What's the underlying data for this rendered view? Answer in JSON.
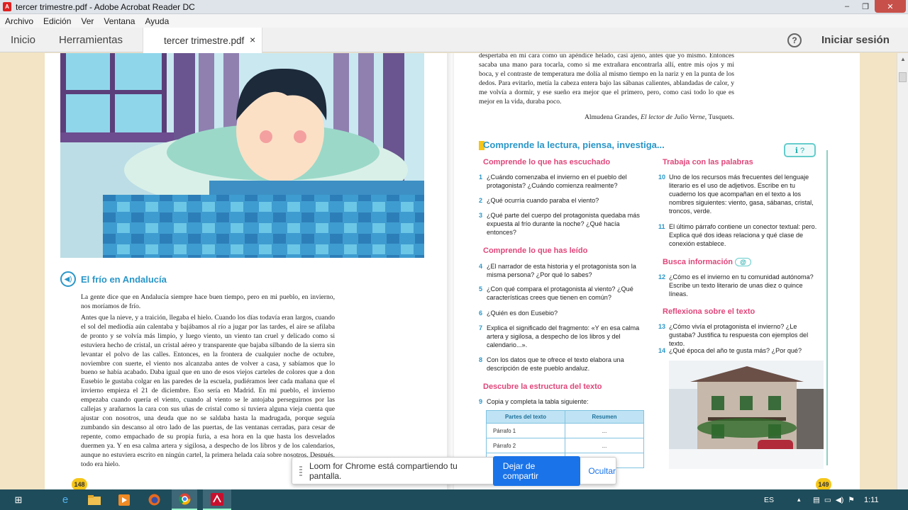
{
  "window": {
    "title": "tercer trimestre.pdf - Adobe Acrobat Reader DC",
    "min": "–",
    "max": "❐",
    "close": "✕"
  },
  "menu": [
    "Archivo",
    "Edición",
    "Ver",
    "Ventana",
    "Ayuda"
  ],
  "tabs": {
    "home": "Inicio",
    "tools": "Herramientas",
    "doc": "tercer trimestre.pdf",
    "doc_close": "×"
  },
  "help_icon": "?",
  "signin": "Iniciar sesión",
  "left_page": {
    "icon": "speaker-icon",
    "title": "El frío en Andalucía",
    "p1": "La gente dice que en Andalucía siempre hace buen tiempo, pero en mi pueblo, en invierno, nos moríamos de frío.",
    "p2": "Antes que la nieve, y a traición, llegaba el hielo. Cuando los días todavía eran largos, cuando el sol del mediodía aún calentaba y bajábamos al río a jugar por las tardes, el aire se afilaba de pronto y se volvía más limpio, y luego viento, un viento tan cruel y delicado como si estuviera hecho de cristal, un cristal aéreo y transparente que bajaba silbando de la sierra sin levantar el polvo de las calles. Entonces, en la frontera de cualquier noche de octubre, noviembre con suerte, el viento nos alcanzaba antes de volver a casa, y sabíamos que lo bueno se había acabado. Daba igual que en uno de esos viejos carteles de colores que a don Eusebio le gustaba colgar en las paredes de la escuela, pudiéramos leer cada mañana que el invierno empieza el 21 de diciembre. Eso sería en Madrid. En mi pueblo, el invierno empezaba cuando quería el viento, cuando al viento se le antojaba perseguirnos por las callejas y arañarnos la cara con sus uñas de cristal como si tuviera alguna vieja cuenta que ajustar con nosotros, una deuda que no se saldaba hasta la madrugada, porque seguía zumbando sin descanso al otro lado de las puertas, de las ventanas cerradas, para cesar de repente, como empachado de su propia furia, a esa hora en la que hasta los desvelados duermen ya. Y en esa calma artera y sigilosa, a despecho de los libros y de los calendarios, aunque no estuviera escrito en ningún cartel, la primera helada caía sobre nosotros. Después, todo era hielo.",
    "page_number": "148"
  },
  "right_page": {
    "top_text": "despertaba en mi cara como un apéndice helado, casi ajeno, antes que yo mismo. Entonces sacaba una mano para tocarla, como si me extrañara encontrarla allí, entre mis ojos y mi boca, y el contraste de temperatura me dolía al mismo tiempo en la nariz y en la punta de los dedos. Para evitarlo, metía la cabeza entera bajo las sábanas calientes, ablandadas de calor, y me volvía a dormir, y ese sueño era mejor que el primero, pero, como casi todo lo que es mejor en la vida, duraba poco.",
    "credit_author": "Almudena Grandes, ",
    "credit_book": "El lector de Julio Verne",
    "credit_publisher": ", Tusquets.",
    "section_first": "C",
    "section_rest": "omprende la lectura, piensa, investiga...",
    "section_badge": "ℹ ?",
    "headings": {
      "h1": "Comprende lo que has escuchado",
      "h2": "Comprende lo que has leído",
      "h3": "Descubre la estructura del texto",
      "h4": "Trabaja con las palabras",
      "h5": "Busca información",
      "h5_badge": "@",
      "h6": "Reflexiona sobre el texto"
    },
    "questions": [
      {
        "n": "1",
        "t": "¿Cuándo comenzaba el invierno en el pueblo del protagonista? ¿Cuándo comienza realmente?"
      },
      {
        "n": "2",
        "t": "¿Qué ocurría cuando paraba el viento?"
      },
      {
        "n": "3",
        "t": "¿Qué parte del cuerpo del protagonista quedaba más expuesta al frío durante la noche? ¿Qué hacía entonces?"
      },
      {
        "n": "4",
        "t": "¿El narrador de esta historia y el protagonista son la misma persona? ¿Por qué lo sabes?"
      },
      {
        "n": "5",
        "t": "¿Con qué compara el protagonista al viento? ¿Qué características crees que tienen en común?"
      },
      {
        "n": "6",
        "t": "¿Quién es don Eusebio?"
      },
      {
        "n": "7",
        "t": "Explica el significado del fragmento: «Y en esa calma artera y sigilosa, a despecho de los libros y del calendario...»."
      },
      {
        "n": "8",
        "t": "Con los datos que te ofrece el texto elabora una descripción de este pueblo andaluz."
      },
      {
        "n": "9",
        "t": "Copia y completa la tabla siguiente:"
      },
      {
        "n": "10",
        "t": "Uno de los recursos más frecuentes del lenguaje literario es el uso de adjetivos. Escribe en tu cuaderno los que acompañan en el texto a los nombres siguientes: viento, gasa, sábanas, cristal, troncos, verde."
      },
      {
        "n": "11",
        "t": "El último párrafo contiene un conector textual: pero. Explica qué dos ideas relaciona y qué clase de conexión establece."
      },
      {
        "n": "12",
        "t": "¿Cómo es el invierno en tu comunidad autónoma? Escribe un texto literario de unas diez o quince líneas."
      },
      {
        "n": "13",
        "t": "¿Cómo vivía el protagonista el invierno? ¿Le gustaba? Justifica tu respuesta con ejemplos del texto."
      },
      {
        "n": "14",
        "t": "¿Qué época del año te gusta más? ¿Por qué?"
      }
    ],
    "table": {
      "headers": [
        "Partes del texto",
        "Resumen"
      ],
      "rows": [
        [
          "Párrafo 1",
          "..."
        ],
        [
          "Párrafo 2",
          "..."
        ],
        [
          "",
          ""
        ]
      ]
    },
    "page_number": "149"
  },
  "loom": {
    "message": "Loom for Chrome está compartiendo tu pantalla.",
    "stop": "Dejar de compartir",
    "hide": "Ocultar"
  },
  "taskbar": {
    "language": "ES",
    "time": "1:11"
  },
  "colors": {
    "accent_blue": "#2a96c8",
    "pink_heading": "#e0467a",
    "loom_blue": "#1a73e8",
    "taskbar": "#1f4c5a",
    "page_bg": "#f2e4c4"
  }
}
